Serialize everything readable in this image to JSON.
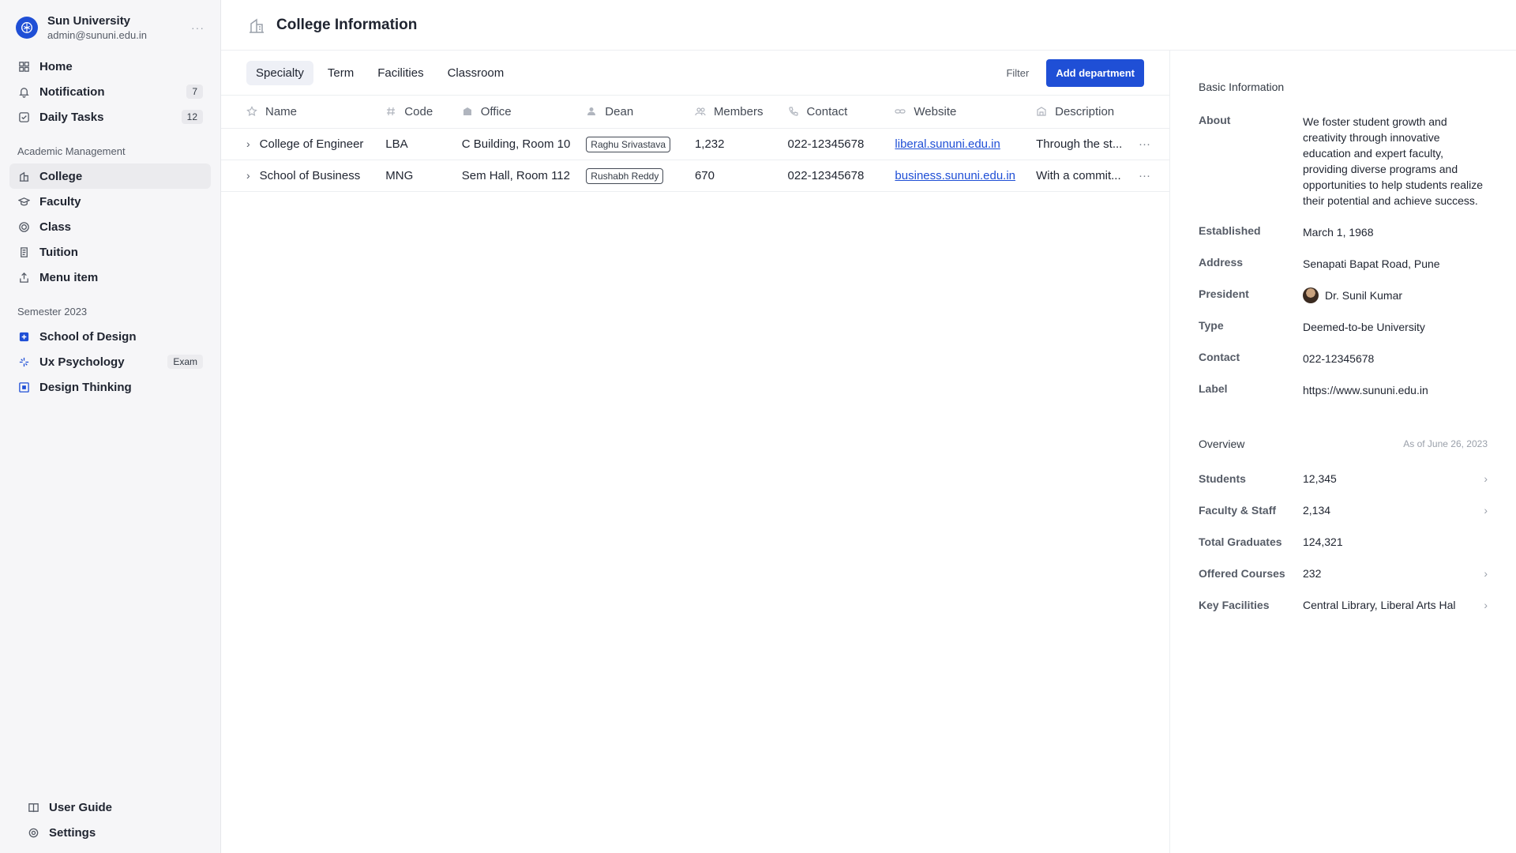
{
  "brand": {
    "name": "Sun University",
    "email": "admin@sununi.edu.in",
    "more": "···"
  },
  "nav": {
    "primary": [
      {
        "label": "Home",
        "icon": "grid-icon"
      },
      {
        "label": "Notification",
        "icon": "bell-icon",
        "count": "7"
      },
      {
        "label": "Daily Tasks",
        "icon": "checkbox-icon",
        "count": "12"
      }
    ],
    "section1_title": "Academic Management",
    "academic": [
      {
        "label": "College",
        "icon": "building-icon"
      },
      {
        "label": "Faculty",
        "icon": "graduation-cap-icon"
      },
      {
        "label": "Class",
        "icon": "spiral-icon"
      },
      {
        "label": "Tuition",
        "icon": "receipt-icon"
      },
      {
        "label": "Menu item",
        "icon": "share-icon"
      }
    ],
    "section2_title": "Semester 2023",
    "semester": [
      {
        "label": "School of Design",
        "icon": "plus-square-icon"
      },
      {
        "label": "Ux Psychology",
        "icon": "sparkle-icon",
        "tag": "Exam"
      },
      {
        "label": "Design Thinking",
        "icon": "square-dot-icon"
      }
    ],
    "bottom": [
      {
        "label": "User Guide",
        "icon": "book-icon"
      },
      {
        "label": "Settings",
        "icon": "gear-icon"
      }
    ]
  },
  "header": {
    "title": "College Information",
    "icon": "building-icon"
  },
  "toolbar": {
    "tabs": [
      "Specialty",
      "Term",
      "Facilities",
      "Classroom"
    ],
    "filter": "Filter",
    "add_button": "Add department"
  },
  "table": {
    "columns": [
      {
        "label": "Name",
        "icon": "star-icon"
      },
      {
        "label": "Code",
        "icon": "hash-icon"
      },
      {
        "label": "Office",
        "icon": "building-icon"
      },
      {
        "label": "Dean",
        "icon": "user-icon"
      },
      {
        "label": "Members",
        "icon": "users-icon"
      },
      {
        "label": "Contact",
        "icon": "phone-icon"
      },
      {
        "label": "Website",
        "icon": "link-icon"
      },
      {
        "label": "Description",
        "icon": "doc-icon"
      }
    ],
    "rows": [
      {
        "name": "College of Engineer",
        "code": "LBA",
        "office": "C Building, Room 10",
        "dean": "Raghu Srivastava",
        "members": "1,232",
        "contact": "022-12345678",
        "website": "liberal.sununi.edu.in",
        "description": "Through the st..."
      },
      {
        "name": "School of Business",
        "code": "MNG",
        "office": "Sem Hall, Room 112",
        "dean": "Rushabh  Reddy",
        "members": "670",
        "contact": "022-12345678",
        "website": "business.sununi.edu.in",
        "description": "With a commit..."
      }
    ]
  },
  "basic_info": {
    "title": "Basic Information",
    "rows": [
      {
        "key": "About",
        "value": "We foster student growth and creativity through innovative education and expert faculty, providing diverse programs and opportunities to help students realize their potential and achieve success."
      },
      {
        "key": "Established",
        "value": "March 1, 1968"
      },
      {
        "key": "Address",
        "value": "Senapati Bapat Road, Pune"
      },
      {
        "key": "President",
        "value": "Dr. Sunil Kumar"
      },
      {
        "key": "Type",
        "value": "Deemed-to-be University"
      },
      {
        "key": "Contact",
        "value": "022-12345678"
      },
      {
        "key": "Label",
        "value": "https://www.sununi.edu.in"
      }
    ]
  },
  "overview": {
    "title": "Overview",
    "date": "As of June 26, 2023",
    "rows": [
      {
        "key": "Students",
        "value": "12,345"
      },
      {
        "key": "Faculty & Staff",
        "value": "2,134"
      },
      {
        "key": "Total Graduates",
        "value": "124,321"
      },
      {
        "key": "Offered Courses",
        "value": "232"
      },
      {
        "key": "Key Facilities",
        "value": "Central Library, Liberal Arts Hal"
      }
    ]
  },
  "colors": {
    "accent": "#1f4fd6",
    "sidebar_bg": "#f6f6f8"
  }
}
